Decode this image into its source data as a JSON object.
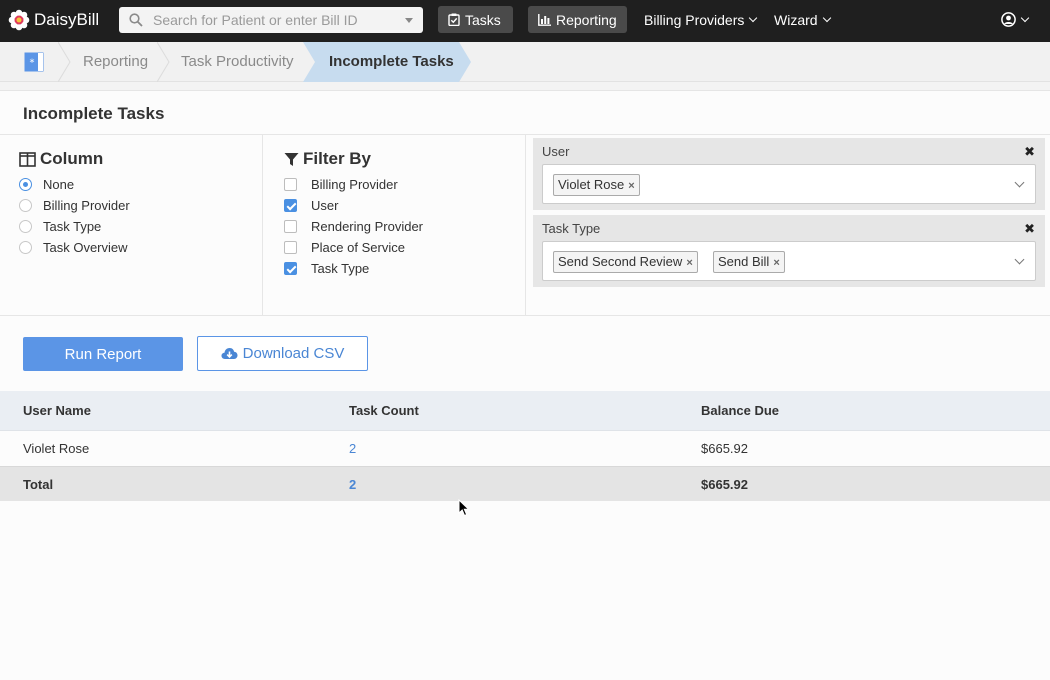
{
  "app": {
    "name": "DaisyBill"
  },
  "topnav": {
    "search_placeholder": "Search for Patient or enter Bill ID",
    "tasks_label": "Tasks",
    "reporting_label": "Reporting",
    "billing_providers_label": "Billing Providers",
    "wizard_label": "Wizard"
  },
  "breadcrumb": [
    "Reporting",
    "Task Productivity",
    "Incomplete Tasks"
  ],
  "page": {
    "title": "Incomplete Tasks"
  },
  "column": {
    "title": "Column",
    "options": [
      "None",
      "Billing Provider",
      "Task Type",
      "Task Overview"
    ],
    "selected": "None"
  },
  "filter_by": {
    "title": "Filter By",
    "options": [
      {
        "label": "Billing Provider",
        "checked": false
      },
      {
        "label": "User",
        "checked": true
      },
      {
        "label": "Rendering Provider",
        "checked": false
      },
      {
        "label": "Place of Service",
        "checked": false
      },
      {
        "label": "Task Type",
        "checked": true
      }
    ]
  },
  "filters": {
    "user": {
      "label": "User",
      "values": [
        "Violet Rose"
      ]
    },
    "task_type": {
      "label": "Task Type",
      "values": [
        "Send Second Review",
        "Send Bill"
      ]
    }
  },
  "actions": {
    "run_report": "Run Report",
    "download_csv": "Download CSV"
  },
  "table": {
    "headers": [
      "User Name",
      "Task Count",
      "Balance Due"
    ],
    "rows": [
      [
        "Violet Rose",
        "2",
        "$665.92"
      ]
    ],
    "total": [
      "Total",
      "2",
      "$665.92"
    ]
  },
  "colors": {
    "accent": "#5b95e6",
    "nav_bg": "#1f1f1f",
    "breadcrumb_active": "#c7dcef"
  }
}
